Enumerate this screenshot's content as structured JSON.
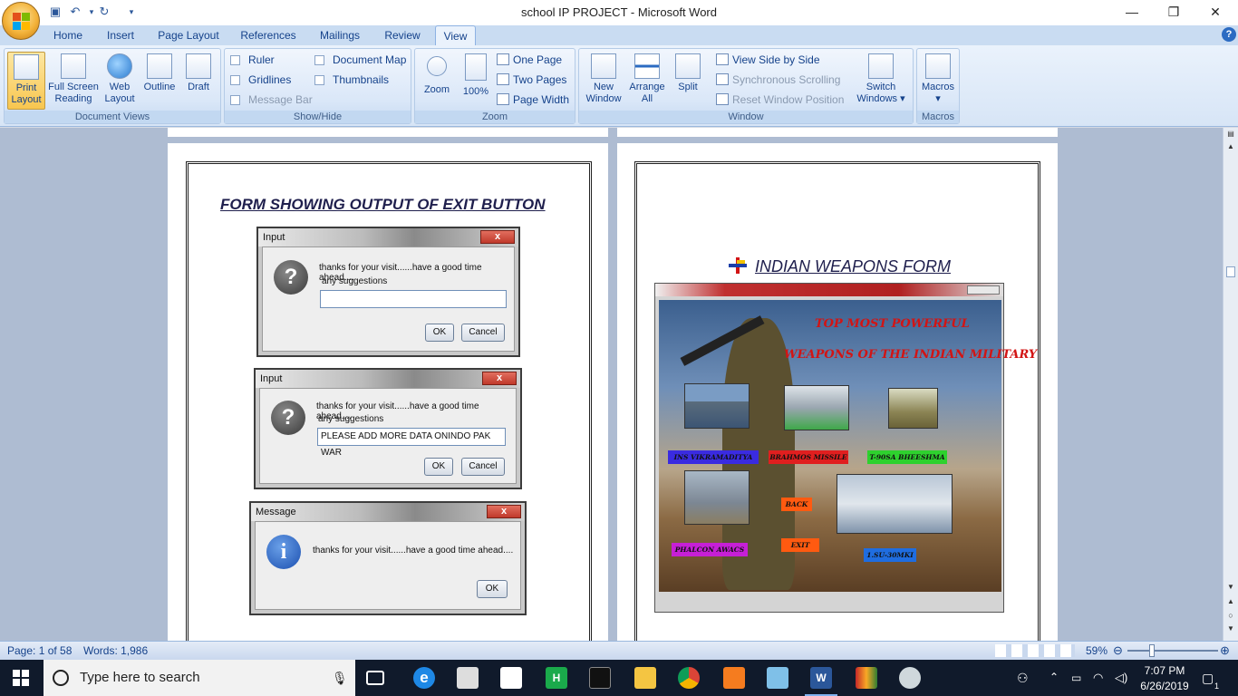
{
  "window": {
    "title": "school IP PROJECT - Microsoft Word"
  },
  "tabs": [
    {
      "label": "Home"
    },
    {
      "label": "Insert"
    },
    {
      "label": "Page Layout"
    },
    {
      "label": "References"
    },
    {
      "label": "Mailings"
    },
    {
      "label": "Review"
    },
    {
      "label": "View"
    }
  ],
  "ribbon": {
    "document_views": {
      "label": "Document Views",
      "buttons": [
        {
          "line1": "Print",
          "line2": "Layout"
        },
        {
          "line1": "Full Screen",
          "line2": "Reading"
        },
        {
          "line1": "Web",
          "line2": "Layout"
        },
        {
          "line1": "Outline",
          "line2": ""
        },
        {
          "line1": "Draft",
          "line2": ""
        }
      ]
    },
    "show_hide": {
      "label": "Show/Hide",
      "ruler": "Ruler",
      "gridlines": "Gridlines",
      "message_bar": "Message Bar",
      "document_map": "Document Map",
      "thumbnails": "Thumbnails"
    },
    "zoom": {
      "label": "Zoom",
      "zoom": "Zoom",
      "hundred": "100%",
      "one_page": "One Page",
      "two_pages": "Two Pages",
      "page_width": "Page Width"
    },
    "window": {
      "label": "Window",
      "new_window_1": "New",
      "new_window_2": "Window",
      "arrange_1": "Arrange",
      "arrange_2": "All",
      "split": "Split",
      "view_side": "View Side by Side",
      "sync_scroll": "Synchronous Scrolling",
      "reset_pos": "Reset Window Position",
      "switch_1": "Switch",
      "switch_2": "Windows ▾"
    },
    "macros": {
      "label": "Macros",
      "button": "Macros",
      "arrow": "▾"
    }
  },
  "page1": {
    "title": "FORM SHOWING OUTPUT OF EXIT BUTTON",
    "dialog1": {
      "title": "Input",
      "close": "x",
      "line1": "thanks for your visit......have a good time ahead....",
      "line2": "any suggestions",
      "value": "",
      "ok": "OK",
      "cancel": "Cancel"
    },
    "dialog2": {
      "title": "Input",
      "close": "x",
      "line1": "thanks for your visit......have a good time ahead....",
      "line2": "any suggestions",
      "value": "PLEASE ADD MORE DATA ONINDO PAK WAR",
      "ok": "OK",
      "cancel": "Cancel"
    },
    "dialog3": {
      "title": "Message",
      "close": "x",
      "line1": "thanks for your visit......have a good time ahead....",
      "ok": "OK"
    }
  },
  "page2": {
    "title": "INDIAN WEAPONS FORM",
    "heading1": "TOP MOST POWERFUL",
    "heading2": "WEAPONS OF THE INDIAN MILITARY",
    "labels": {
      "vikramaditya": "INS VIKRAMADITYA",
      "brahmos": "BRAHMOS MISSILE",
      "bheeshma": "T-90SA BHEESHMA",
      "back": "BACK",
      "phalcon": "PHALCON AWACS",
      "exit": "EXIT",
      "su30": "1.SU-30MKI"
    },
    "colors": {
      "vikramaditya": "#3a2be0",
      "brahmos": "#e01f1f",
      "bheeshma": "#2ed12e",
      "back": "#ff5a10",
      "phalcon": "#c61fd6",
      "exit": "#ff5a10",
      "su30": "#1f6de0"
    }
  },
  "status": {
    "page": "Page: 1 of 58",
    "words": "Words: 1,986",
    "zoom": "59%"
  },
  "taskbar": {
    "search_placeholder": "Type here to search",
    "time": "7:07 PM",
    "date": "6/26/2019",
    "notifications": "1"
  }
}
